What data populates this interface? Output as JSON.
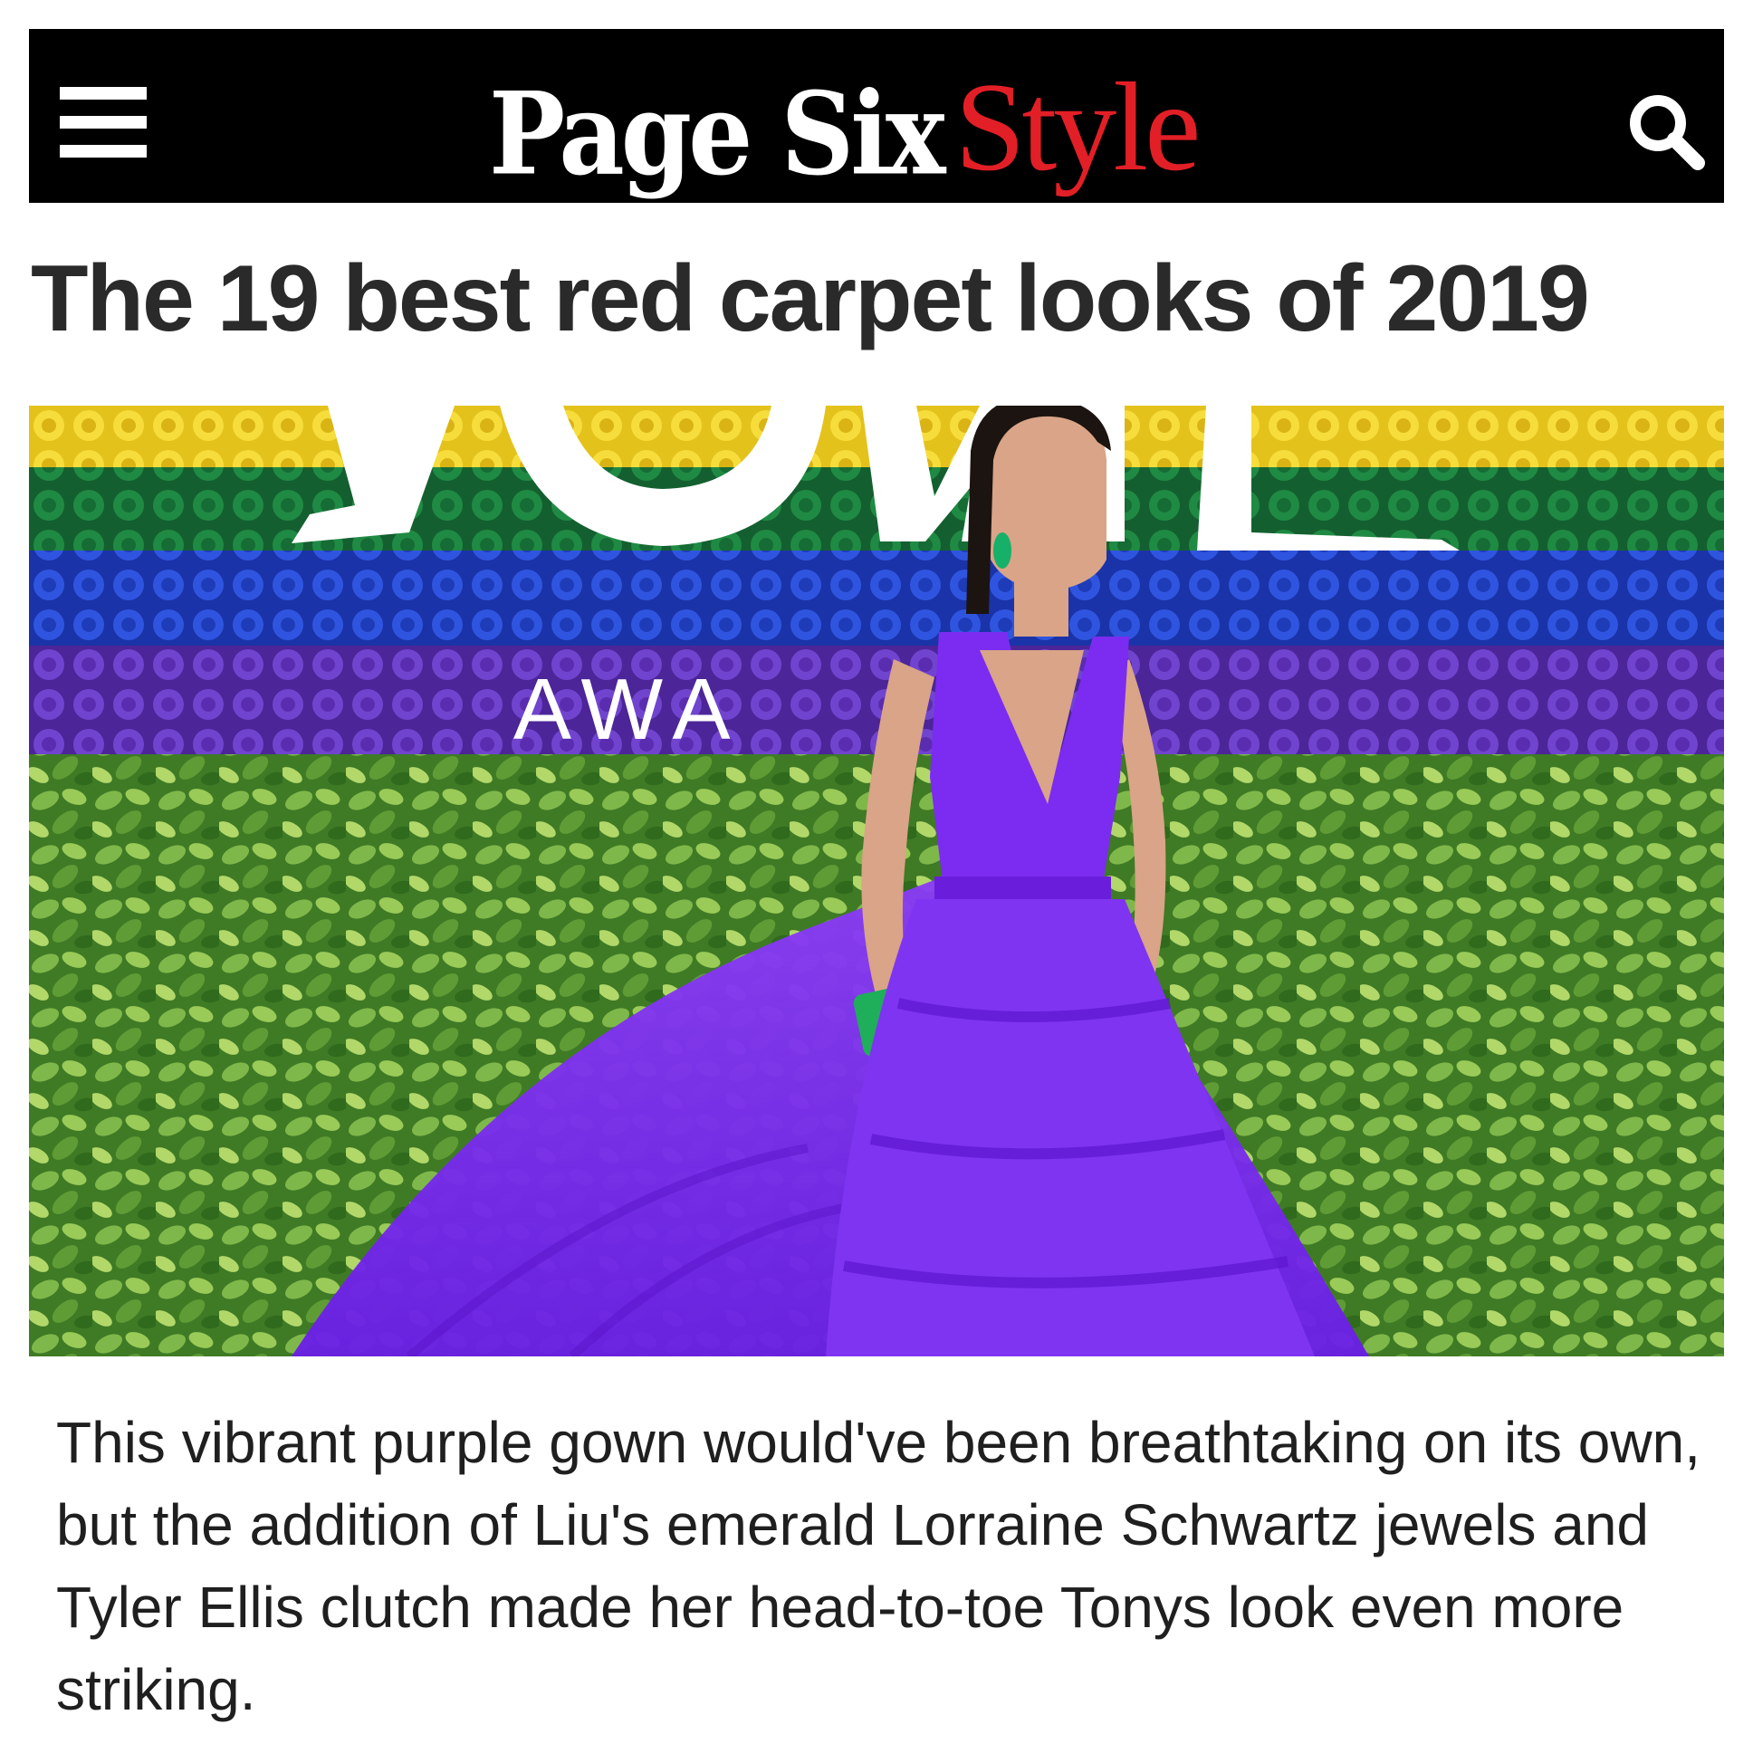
{
  "header": {
    "menu_icon": "hamburger-menu-icon",
    "logo_primary": "Page Six",
    "logo_accent": "Style",
    "logo_accent_color": "#e21f26",
    "background_color": "#000000",
    "search_icon": "search-icon"
  },
  "article": {
    "title": "The 19 best red carpet looks of 2019",
    "image": {
      "backdrop_letters": "AWA",
      "stripe_colors": [
        "#f2d22e",
        "#1f8a43",
        "#2346d0",
        "#6a38c8",
        "#4f8a2c"
      ],
      "gown_color": "#7b2cf0"
    },
    "caption": "This vibrant purple gown would've been breathtaking on its own, but the addition of Liu's emerald Lorraine Schwartz jewels and Tyler Ellis clutch made her head-to-toe Tonys look even more striking."
  }
}
